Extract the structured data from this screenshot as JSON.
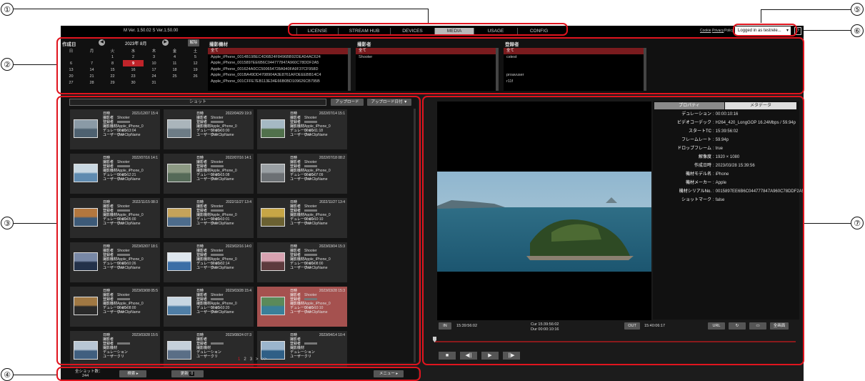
{
  "callouts": [
    "①",
    "②",
    "③",
    "④",
    "⑤",
    "⑥",
    "⑦"
  ],
  "topbar": {
    "version": "M Ver. 1.50.02 S Ver.1.50.00",
    "tabs": [
      "LICENSE",
      "STREAM HUB",
      "DEVICES",
      "MEDIA",
      "USAGE",
      "CONFIG"
    ],
    "active_tab": "MEDIA",
    "links": [
      "Cookie",
      "Privacy",
      "Policy"
    ],
    "user_menu": "Logged in as testrele...",
    "help": "?"
  },
  "filters": {
    "date_label": "作成日",
    "month": "2023年 8月",
    "clear_button": "解除",
    "weekdays": [
      "日",
      "月",
      "火",
      "水",
      "木",
      "金",
      "土"
    ],
    "weeks": [
      [
        "",
        "",
        "1",
        "2",
        "3",
        "4",
        "5"
      ],
      [
        "6",
        "7",
        "8",
        "9",
        "10",
        "11",
        "12"
      ],
      [
        "13",
        "14",
        "15",
        "16",
        "17",
        "18",
        "19"
      ],
      [
        "20",
        "21",
        "22",
        "23",
        "24",
        "25",
        "26"
      ],
      [
        "27",
        "28",
        "29",
        "30",
        "31",
        "",
        ""
      ]
    ],
    "selected_day": "9",
    "material_label": "撮影機材",
    "materials": [
      "全て",
      "Apple_iPhone_0014B19BEC4D6B24F8496BB92DEA54AC624",
      "Apple_iPhone_0015897EE6B6C044777847A960C78DDF2A5",
      "Apple_iPhone_001624A0CC500654728A940FA9F37CF958D",
      "Apple_iPhone_001BA49DD4708904A3E8761AFDEEEBB14C4",
      "Apple_iPhone_001CFFE7EB113E34E66B0BD109626CB795B"
    ],
    "shooter_label": "撮影者",
    "shooters": [
      "全て",
      "Shooter"
    ],
    "registrant_label": "登録者",
    "registrants": [
      "全て",
      "cstest",
      "",
      "",
      "proavuser",
      "r11f"
    ]
  },
  "shots": {
    "search_label": "ショット",
    "upload_button": "アップロード",
    "sort_button": "アップロード日付 ▼",
    "keys": [
      "日時",
      "撮影者",
      "登録者",
      "撮影機材",
      "デュレーション",
      "ユーザークリ"
    ],
    "items": [
      {
        "date": "2021/12/07 15:4",
        "shooter": "Shooter",
        "device": "Apple_iPhone_0",
        "duration": "00:00:13:04",
        "clip": "UserClipName"
      },
      {
        "date": "2022/04/29 19:3",
        "shooter": "Shooter",
        "device": "Apple_iPhone_0",
        "duration": "00:00:03:00",
        "clip": "UserClipName"
      },
      {
        "date": "2022/07/14 15:1",
        "shooter": "Shooter",
        "device": "Apple_iPhone_0",
        "duration": "00:00:11:18",
        "clip": "UserClipName"
      },
      {
        "date": "2022/07/16 14:1",
        "shooter": "Shooter",
        "device": "Apple_iPhone_0",
        "duration": "00:00:12:21",
        "clip": "UserClipName"
      },
      {
        "date": "2022/07/16 14:1",
        "shooter": "Shooter",
        "device": "Apple_iPhone_0",
        "duration": "00:00:15:08",
        "clip": "UserClipName"
      },
      {
        "date": "2022/07/18 08:2",
        "shooter": "Shooter",
        "device": "Apple_iPhone_0",
        "duration": "00:00:07:09",
        "clip": "UserClipName"
      },
      {
        "date": "2022/11/15 08:3",
        "shooter": "Shooter",
        "device": "Apple_iPhone_0",
        "duration": "00:00:05:00",
        "clip": "UserClipName"
      },
      {
        "date": "2022/11/27 13:4",
        "shooter": "Shooter",
        "device": "Apple_iPhone_0",
        "duration": "00:00:10:01",
        "clip": "UserClipName"
      },
      {
        "date": "2022/11/27 13:4",
        "shooter": "Shooter",
        "device": "Apple_iPhone_0",
        "duration": "00:00:10:10",
        "clip": "UserClipName"
      },
      {
        "date": "2023/02/07 18:1",
        "shooter": "Shooter",
        "device": "Apple_iPhone_0",
        "duration": "00:00:10:26",
        "clip": "UserClipName"
      },
      {
        "date": "2023/02/16 14:0",
        "shooter": "Shooter",
        "device": "Apple_iPhone_0",
        "duration": "00:00:32:14",
        "clip": "UserClipName"
      },
      {
        "date": "2023/03/04 15:3",
        "shooter": "Shooter",
        "device": "Apple_iPhone_0",
        "duration": "00:00:08:00",
        "clip": "UserClipName"
      },
      {
        "date": "2023/03/08 05:5",
        "shooter": "Shooter",
        "device": "Apple_iPhone_0",
        "duration": "00:00:08:00",
        "clip": "UserClipName"
      },
      {
        "date": "2023/03/28 15:4",
        "shooter": "Shooter",
        "device": "Apple_iPhone_0",
        "duration": "00:00:10:20",
        "clip": "UserClipName"
      },
      {
        "date": "2023/03/28 15:3",
        "shooter": "Shooter",
        "device": "Apple_iPhone_0",
        "duration": "00:00:10:10",
        "clip": "UserClipName"
      },
      {
        "date": "2023/03/28 15:5",
        "shooter": "",
        "device": "",
        "duration": "",
        "clip": ""
      },
      {
        "date": "2023/08/24 07:3",
        "shooter": "",
        "device": "",
        "duration": "",
        "clip": ""
      },
      {
        "date": "2023/04/14 10:4",
        "shooter": "",
        "device": "",
        "duration": "",
        "clip": ""
      }
    ],
    "selected_index": 14,
    "pagination": [
      "1",
      "2",
      "3",
      ">",
      ">>"
    ]
  },
  "bottombar": {
    "total_label": "全ショット数：",
    "total_count": "244",
    "search_button": "検索",
    "refresh_button": "更新",
    "refresh_count": "0",
    "menu_button": "メニュー"
  },
  "viewer": {
    "tab_properties": "プロパティ",
    "tab_metadata": "メタデータ",
    "properties": [
      {
        "k": "デュレーション",
        "v": "00:00:10:16"
      },
      {
        "k": "ビデオコーデック",
        "v": "H264_420_LongGOP 16.24Mbps / 59.94p"
      },
      {
        "k": "スタートTC",
        "v": "15:39:56:02"
      },
      {
        "k": "フレームレート",
        "v": "59.94p"
      },
      {
        "k": "ドロップフレーム",
        "v": "true"
      },
      {
        "k": "解像度",
        "v": "1920 × 1080"
      },
      {
        "k": "作成日時",
        "v": "2023/03/28 15:39:56"
      },
      {
        "k": "機材モデル名",
        "v": "iPhone"
      },
      {
        "k": "機材メーカー",
        "v": "Apple"
      },
      {
        "k": "機材シリアルNo.",
        "v": "0015897EE6B6C044777847A960C78DDF2A5"
      },
      {
        "k": "ショットマーク",
        "v": "false"
      }
    ],
    "in_label": "IN",
    "in_tc": "15:39:56:02",
    "cur_tc": "Cur  15:39:56:02",
    "dur_tc": "Dur  00:00:10:16",
    "out_label": "OUT",
    "out_tc": "15:40:06:17",
    "url_button": "URL",
    "fullscreen_button": "全画面",
    "transport": [
      "■",
      "◀||",
      "▶",
      "||▶"
    ]
  },
  "colors": {
    "accent_red": "#e0141e",
    "selected_card": "#a5514f",
    "selected_list": "#7a1b1e"
  }
}
